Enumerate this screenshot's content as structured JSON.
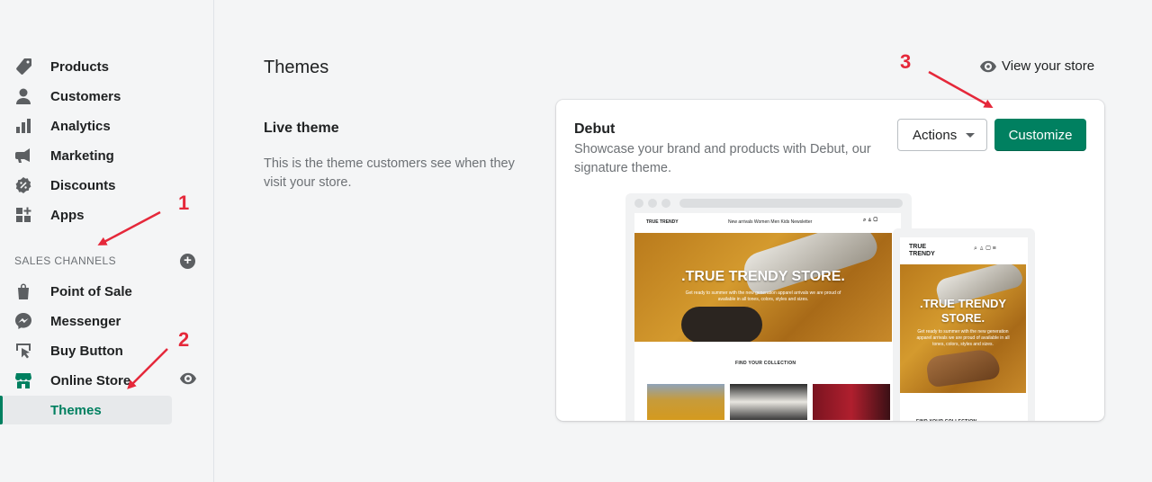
{
  "sidebar": {
    "items": [
      {
        "label": "Products",
        "icon": "tag-icon"
      },
      {
        "label": "Customers",
        "icon": "person-icon"
      },
      {
        "label": "Analytics",
        "icon": "bar-chart-icon"
      },
      {
        "label": "Marketing",
        "icon": "megaphone-icon"
      },
      {
        "label": "Discounts",
        "icon": "discount-icon"
      },
      {
        "label": "Apps",
        "icon": "apps-icon"
      }
    ],
    "sales_channels_heading": "SALES CHANNELS",
    "channels": [
      {
        "label": "Point of Sale",
        "icon": "shopify-bag-icon"
      },
      {
        "label": "Messenger",
        "icon": "messenger-icon"
      },
      {
        "label": "Buy Button",
        "icon": "buy-button-icon"
      },
      {
        "label": "Online Store",
        "icon": "store-icon"
      }
    ],
    "active_sub_item": "Themes"
  },
  "annotations": [
    "1",
    "2",
    "3"
  ],
  "main": {
    "title": "Themes",
    "view_store": "View your store",
    "live_theme": {
      "title": "Live theme",
      "description": "This is the theme customers see when they visit your store."
    },
    "theme_card": {
      "name": "Debut",
      "description": "Showcase your brand and products with Debut, our signature theme.",
      "actions_label": "Actions",
      "customize_label": "Customize"
    },
    "preview": {
      "logo_desktop": "TRUE TRENDY",
      "logo_mobile_line1": "TRUE",
      "logo_mobile_line2": "TRENDY",
      "nav_links": "New arrivals   Women   Men   Kids   Newsletter",
      "hero_title": ".TRUE TRENDY STORE.",
      "hero_text": "Get ready to summer with the new generation apparel arrivals we are proud of available in all tones, colors, styles and sizes.",
      "collection_heading": "FIND YOUR COLLECTION"
    }
  },
  "colors": {
    "accent": "#008060",
    "annotation": "#e5283a"
  }
}
